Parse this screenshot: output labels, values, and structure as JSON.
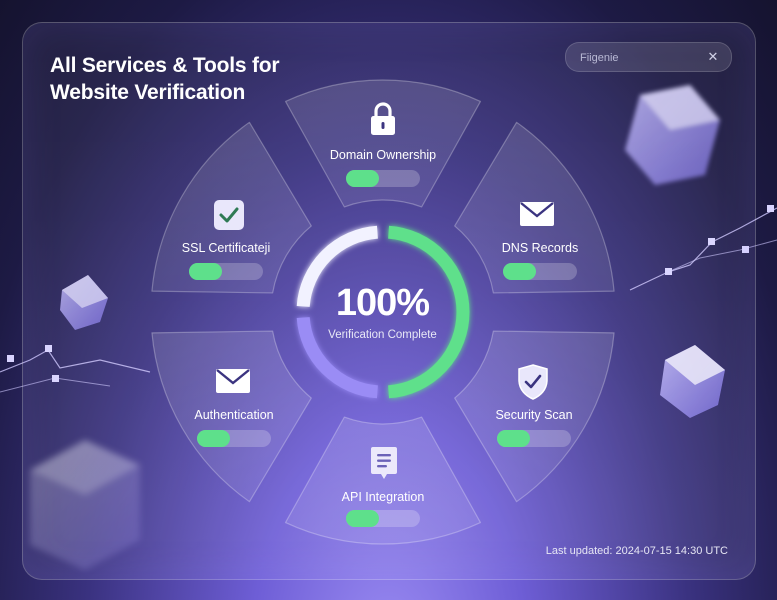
{
  "header": {
    "title": "All Services & Tools for Website Verification"
  },
  "search": {
    "placeholder": "Fiigenie",
    "clear_icon": "close-icon"
  },
  "progress": {
    "percent_label": "100%",
    "value": 100,
    "status": "Verification Complete"
  },
  "services": [
    {
      "key": "domain",
      "label": "Domain Ownership",
      "icon": "lock-icon",
      "toggle_fill": 0.45
    },
    {
      "key": "dns",
      "label": "DNS Records",
      "icon": "envelope-icon",
      "toggle_fill": 0.45
    },
    {
      "key": "security",
      "label": "Security Scan",
      "icon": "shield-check-icon",
      "toggle_fill": 0.45
    },
    {
      "key": "api",
      "label": "API Integration",
      "icon": "document-icon",
      "toggle_fill": 0.45
    },
    {
      "key": "auth",
      "label": "Authentication",
      "icon": "envelope-icon",
      "toggle_fill": 0.45
    },
    {
      "key": "ssl",
      "label": "SSL Certificateji",
      "icon": "checkbox-icon",
      "toggle_fill": 0.45
    }
  ],
  "footer": {
    "last_updated": "Last updated: 2024-07-15 14:30 UTC"
  },
  "colors": {
    "accent_green": "#5ee08b",
    "accent_purple": "#9a8cf5",
    "ring_white": "#f2f2ff"
  }
}
